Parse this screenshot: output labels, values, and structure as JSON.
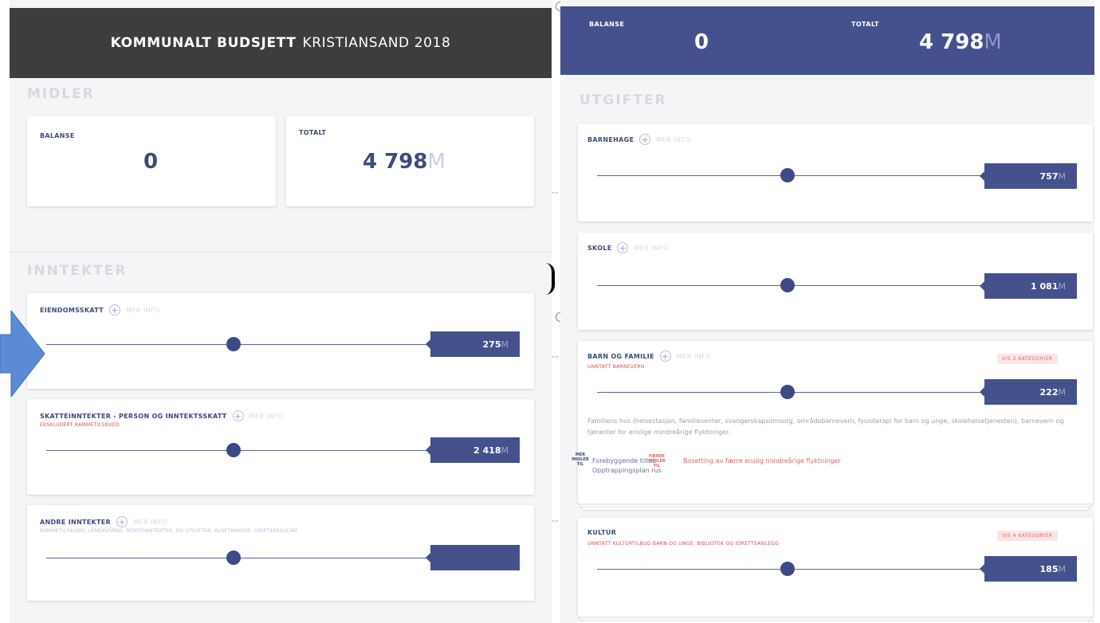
{
  "colors": {
    "header_dark": "#3d3d3d",
    "brand_blue": "#45518c",
    "accent_red": "#e06464",
    "arrow_blue": "#5b8bd6"
  },
  "left": {
    "header": {
      "bold": "KOMMUNALT BUDSJETT",
      "light": "KRISTIANSAND 2018"
    },
    "midler": {
      "label": "MIDLER",
      "balanse": {
        "label": "BALANSE",
        "value": "0"
      },
      "totalt": {
        "label": "TOTALT",
        "value": "4 798",
        "unit": "M"
      }
    },
    "inntekter": {
      "label": "INNTEKTER",
      "cards": [
        {
          "title": "EIENDOMSSKATT",
          "more": "MER INFO",
          "subtitle": "",
          "value": "275",
          "unit": "M",
          "slider": 0.5
        },
        {
          "title": "SKATTEINNTEKTER - PERSON OG INNTEKTSSKATT",
          "more": "MER INFO",
          "subtitle": "EKSKLUDERT RAMMETILSKUDD",
          "value": "2 418",
          "unit": "M",
          "slider": 0.5
        },
        {
          "title": "ANDRE INNTEKTER",
          "more": "MER INFO",
          "subtitle": "RAMMETILSKUDD, LÅNEAVDRAG, RENTEINNTEKTER- OG UTGIFTER, AVSETNINGER, DRIFTSRESULTAT",
          "value": "",
          "unit": "",
          "slider": 0.5
        }
      ]
    }
  },
  "right": {
    "top": {
      "balanse_label": "BALANSE",
      "balanse_value": "0",
      "totalt_label": "TOTALT",
      "totalt_value": "4 798",
      "totalt_unit": "M"
    },
    "utgifter": {
      "label": "UTGIFTER",
      "cards": [
        {
          "title": "BARNEHAGE",
          "more": "MER INFO",
          "value": "757",
          "unit": "M",
          "slider": 0.5
        },
        {
          "title": "SKOLE",
          "more": "MER INFO",
          "value": "1 081",
          "unit": "M",
          "slider": 0.5
        },
        {
          "title": "BARN OG FAMILIE",
          "more": "MER INFO",
          "subtitle": "UNNTATT BARNEVERN",
          "badge": "VIS 2 KATEGORIER",
          "value": "222",
          "unit": "M",
          "slider": 0.5,
          "description": "Familiens hus (helsestasjon, familiesenter, svangerskapsomsorg, områdebarnevern, fysioterapi for barn og unge, skolehelsetjenesten), barnevern og tjenester for enslige mindreårige flyktninger.",
          "side_more": "MER MIDLER TIL",
          "side_less": "FÆRRE MIDLER TIL",
          "link1": "Forebyggende tiltak",
          "link2": "Opptrappingsplan rus",
          "red_link": "Bosetting av færre enslig mindreårige flyktninger"
        },
        {
          "title": "KULTUR",
          "more": "",
          "subtitle": "UNNTATT KULTURTILBUD BARN OG UNGE, BIBLIOTEK OG IDRETTSANLEGG",
          "badge": "VIS 4 KATEGORIER",
          "value": "185",
          "unit": "M",
          "slider": 0.5
        }
      ]
    }
  }
}
